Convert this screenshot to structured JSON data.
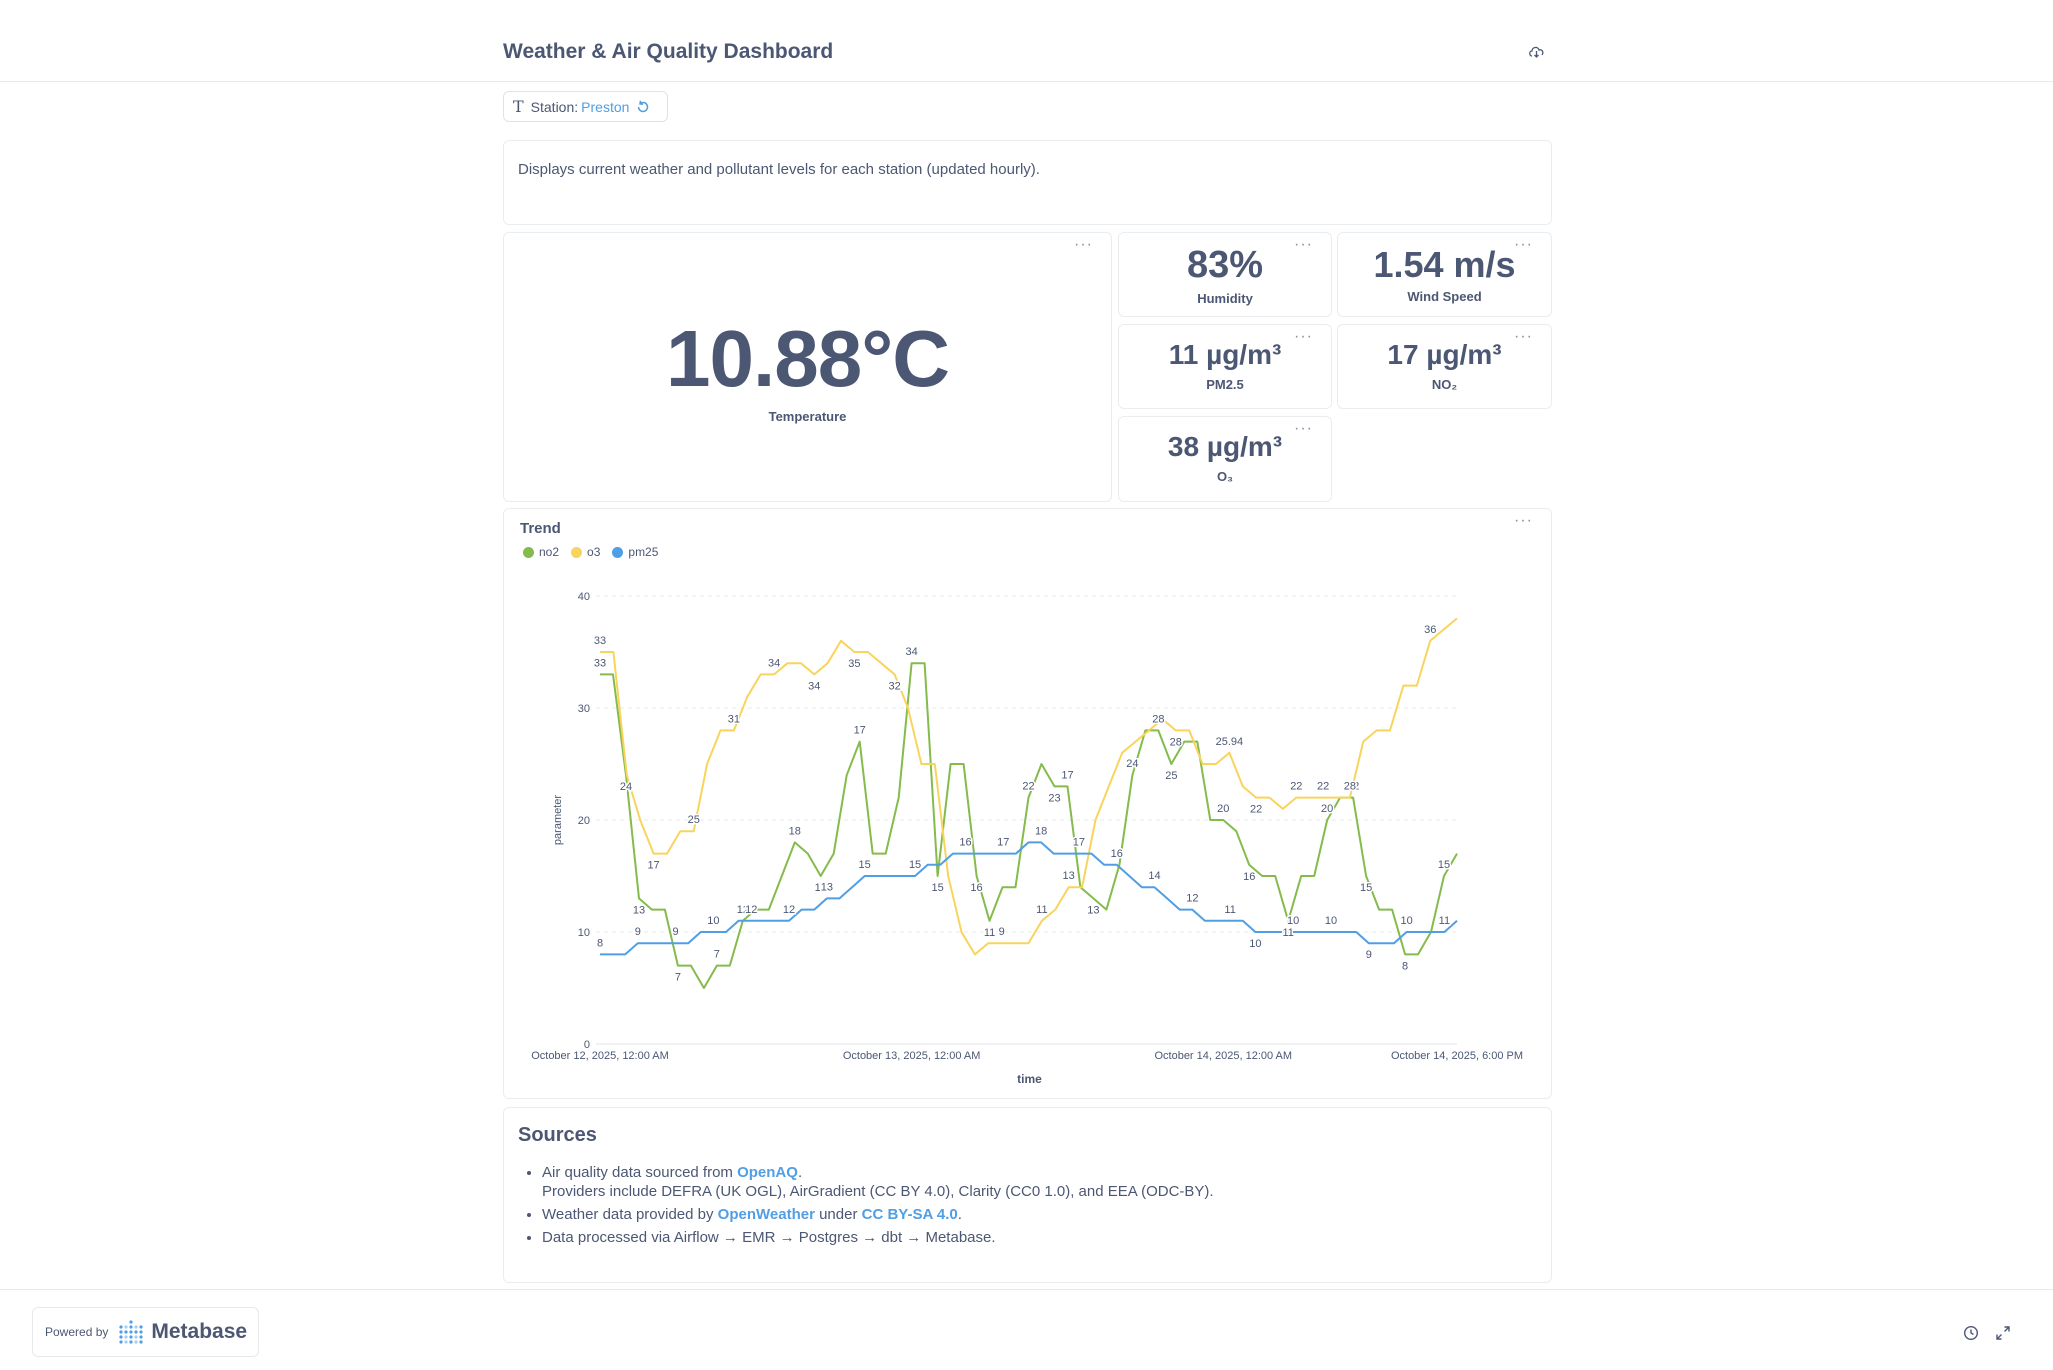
{
  "header": {
    "title": "Weather & Air Quality Dashboard",
    "download_icon": "cloud-download-icon"
  },
  "filter": {
    "label": "Station:",
    "value": "Preston",
    "type_icon": "text-type-icon",
    "reset_icon": "reset-icon"
  },
  "description": "Displays current weather and pollutant levels for each station (updated hourly).",
  "scalars": {
    "temperature": {
      "value": "10.88°C",
      "label": "Temperature"
    },
    "humidity": {
      "value": "83%",
      "label": "Humidity"
    },
    "wind": {
      "value": "1.54 m/s",
      "label": "Wind Speed"
    },
    "pm25": {
      "value": "11 µg/m³",
      "label": "PM2.5"
    },
    "no2": {
      "value": "17 µg/m³",
      "label": "NO₂"
    },
    "o3": {
      "value": "38 µg/m³",
      "label": "O₃"
    }
  },
  "menu_glyph": "···",
  "trend": {
    "title": "Trend",
    "legend": [
      {
        "name": "no2",
        "color": "#84bb4c"
      },
      {
        "name": "o3",
        "color": "#f9d45c"
      },
      {
        "name": "pm25",
        "color": "#509ee3"
      }
    ]
  },
  "chart_data": {
    "type": "line",
    "title": "Trend",
    "xlabel": "time",
    "ylabel": "parameter",
    "ylim": [
      0,
      40
    ],
    "yticks": [
      0,
      10,
      20,
      30,
      40
    ],
    "x_start": "2025-10-12T00:00",
    "x_end": "2025-10-14T18:00",
    "xticks": [
      {
        "label": "October 12, 2025, 12:00 AM",
        "hour": 0
      },
      {
        "label": "October 13, 2025, 12:00 AM",
        "hour": 24
      },
      {
        "label": "October 14, 2025, 12:00 AM",
        "hour": 48
      },
      {
        "label": "October 14, 2025, 6:00 PM",
        "hour": 66
      }
    ],
    "grid": "horizontal",
    "legend_position": "top-left",
    "series": [
      {
        "name": "no2",
        "color": "#84bb4c",
        "values": [
          33,
          33,
          24,
          13,
          12,
          12,
          7,
          7,
          5,
          7,
          7,
          11,
          12,
          12,
          15,
          18,
          17,
          15,
          17,
          24,
          27,
          17,
          17,
          22,
          34,
          34,
          15,
          25,
          25,
          15,
          11,
          14,
          14,
          22,
          25,
          23,
          23,
          14,
          13,
          12,
          16,
          24,
          28,
          28,
          25,
          27,
          27,
          20,
          20,
          19,
          16,
          15,
          15,
          11,
          15,
          15,
          20,
          22,
          22,
          15,
          12,
          12,
          8,
          8,
          10,
          15,
          17
        ],
        "labels": [
          [
            0,
            33
          ],
          [
            2,
            24
          ],
          [
            3,
            13
          ],
          [
            6,
            7
          ],
          [
            9,
            7
          ],
          [
            11,
            12
          ],
          [
            15,
            18
          ],
          [
            17,
            17
          ],
          [
            20,
            17
          ],
          [
            24,
            34
          ],
          [
            26,
            15
          ],
          [
            29,
            16
          ],
          [
            30,
            11
          ],
          [
            33,
            22
          ],
          [
            35,
            23
          ],
          [
            36,
            17
          ],
          [
            38,
            13
          ],
          [
            41,
            24
          ],
          [
            43,
            28
          ],
          [
            44,
            25
          ],
          [
            48,
            20
          ],
          [
            50,
            16
          ],
          [
            53,
            11
          ],
          [
            56,
            20
          ],
          [
            58,
            22
          ],
          [
            59,
            15
          ],
          [
            62,
            8
          ],
          [
            65,
            15
          ]
        ]
      },
      {
        "name": "o3",
        "color": "#f9d45c",
        "values": [
          35,
          35,
          24,
          20,
          17,
          17,
          19,
          19,
          25,
          28,
          28,
          31,
          33,
          33,
          34,
          34,
          33,
          34,
          36,
          35,
          35,
          34,
          33,
          30,
          25,
          25,
          15,
          10,
          8,
          9,
          9,
          9,
          9,
          11,
          12,
          14,
          14,
          20,
          23,
          26,
          27,
          28,
          29,
          28,
          28,
          25,
          25,
          26,
          23,
          22,
          22,
          21,
          22,
          22,
          22,
          22,
          22,
          27,
          28,
          28,
          32,
          32,
          36,
          37,
          38
        ],
        "labels": [
          [
            0,
            33
          ],
          [
            4,
            17
          ],
          [
            7,
            25
          ],
          [
            10,
            31
          ],
          [
            13,
            34
          ],
          [
            16,
            34
          ],
          [
            19,
            35
          ],
          [
            22,
            32
          ],
          [
            30,
            9
          ],
          [
            33,
            11
          ],
          [
            35,
            13
          ],
          [
            43,
            28
          ],
          [
            47,
            25.94
          ],
          [
            49,
            22
          ],
          [
            52,
            22
          ],
          [
            54,
            22
          ],
          [
            56,
            28
          ],
          [
            62,
            36
          ]
        ]
      },
      {
        "name": "pm25",
        "color": "#509ee3",
        "values": [
          8,
          8,
          8,
          9,
          9,
          9,
          9,
          9,
          10,
          10,
          10,
          11,
          11,
          11,
          11,
          11,
          12,
          12,
          13,
          13,
          14,
          15,
          15,
          15,
          15,
          15,
          16,
          16,
          17,
          17,
          17,
          17,
          17,
          17,
          18,
          18,
          17,
          17,
          17,
          17,
          16,
          16,
          15,
          14,
          14,
          13,
          12,
          12,
          11,
          11,
          11,
          11,
          10,
          10,
          10,
          10,
          10,
          10,
          10,
          10,
          10,
          9,
          9,
          9,
          10,
          10,
          10,
          10,
          11
        ],
        "labels": [
          [
            0,
            8
          ],
          [
            3,
            9
          ],
          [
            6,
            9
          ],
          [
            9,
            10
          ],
          [
            12,
            12
          ],
          [
            15,
            12
          ],
          [
            18,
            13
          ],
          [
            21,
            15
          ],
          [
            25,
            15
          ],
          [
            29,
            16
          ],
          [
            32,
            17
          ],
          [
            35,
            18
          ],
          [
            38,
            17
          ],
          [
            41,
            16
          ],
          [
            44,
            14
          ],
          [
            47,
            12
          ],
          [
            50,
            11
          ],
          [
            52,
            10
          ],
          [
            55,
            10
          ],
          [
            58,
            10
          ],
          [
            61,
            9
          ],
          [
            64,
            10
          ],
          [
            67,
            11
          ]
        ]
      }
    ]
  },
  "sources": {
    "title": "Sources",
    "item1_pre": "Air quality data sourced from ",
    "item1_link": "OpenAQ",
    "item1_post": ".",
    "item1_line2": "Providers include DEFRA (UK OGL), AirGradient (CC BY 4.0), Clarity (CC0 1.0), and EEA (ODC-BY).",
    "item2_pre": "Weather data provided by ",
    "item2_link1": "OpenWeather",
    "item2_mid": " under ",
    "item2_link2": "CC BY-SA 4.0",
    "item2_post": ".",
    "item3": "Data processed via Airflow → EMR → Postgres → dbt → Metabase."
  },
  "footer": {
    "powered_by": "Powered by",
    "brand": "Metabase",
    "history_icon": "clock-icon",
    "fullscreen_icon": "expand-icon"
  }
}
